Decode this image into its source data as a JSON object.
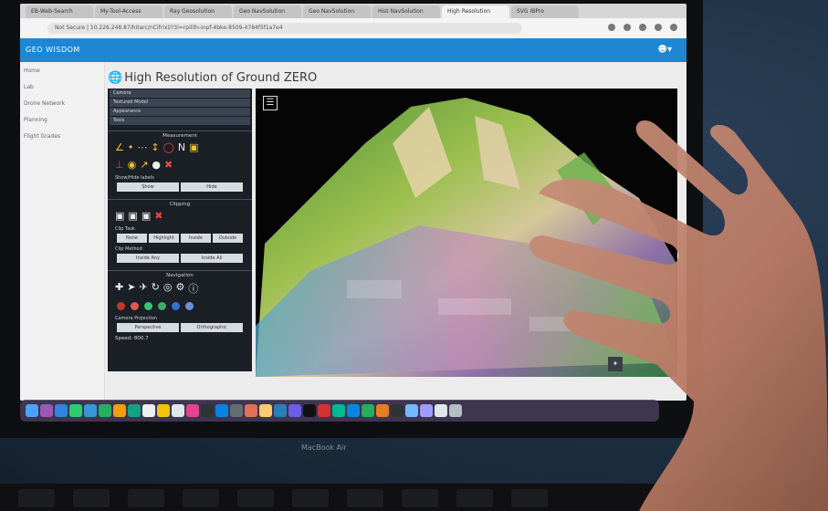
{
  "browser": {
    "tabs": [
      "EB-Web-Search",
      "My-Tool-Access",
      "Ray Geosolution",
      "Geo NavSolution",
      "Geo NavSolution",
      "Hist NavSolution",
      "High Resolution",
      "SVG IBPro"
    ],
    "url": "Not Secure | 10.226.248.87/hitarc/nCifrixl/?3i=rpilifn-inpf-4bke-8509-4784f5f1a7e4",
    "app_brand": "GEO WISDOM"
  },
  "left_nav": {
    "items": [
      "Home",
      "Lab",
      "Drone Network",
      "Planning",
      "Flight Grades"
    ]
  },
  "page": {
    "title": "High Resolution of Ground ZERO"
  },
  "potree": {
    "accordion": [
      "Camera",
      "Textured Model",
      "Appearance",
      "Tools"
    ],
    "measurement_title": "Measurement",
    "show_label": "Show/Hide labels",
    "show_buttons": [
      "Show",
      "Hide"
    ],
    "clipping_title": "Clipping",
    "clip_task_label": "Clip Task",
    "clip_task_buttons": [
      "None",
      "Highlight",
      "Inside",
      "Outside"
    ],
    "clip_method_label": "Clip Method",
    "clip_method_buttons": [
      "Inside Any",
      "Inside All"
    ],
    "navigation_title": "Navigation",
    "projection_label": "Camera Projection",
    "projection_buttons": [
      "Perspective",
      "Orthographic"
    ],
    "speed_label": "Speed: 800.7"
  },
  "laptop": {
    "label": "MacBook Air"
  },
  "colors": {
    "appbar": "#1d87d4",
    "panel": "#1b1f26",
    "tool_accent": "#f1c232"
  }
}
